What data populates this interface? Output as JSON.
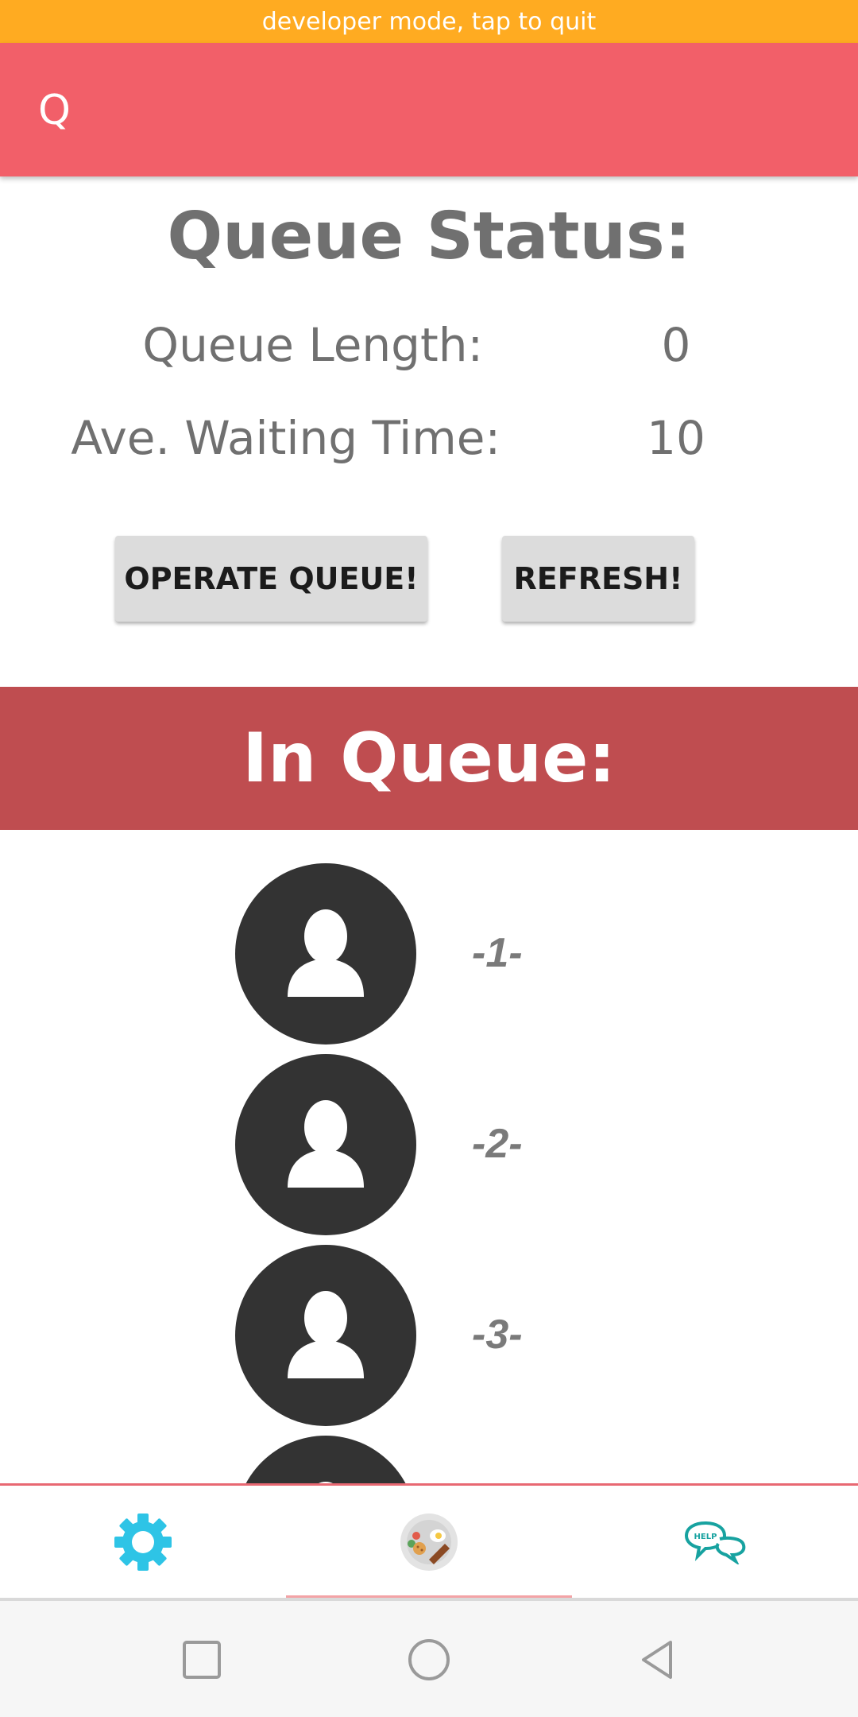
{
  "dev_banner": {
    "text": "developer mode, tap to quit"
  },
  "app_bar": {
    "title": "Q",
    "color": "#F25F69"
  },
  "queue_status": {
    "title": "Queue Status:",
    "length_label": "Queue Length:",
    "length_value": "0",
    "wait_label": "Ave. Waiting Time:",
    "wait_value": "10"
  },
  "actions": {
    "operate_label": "OPERATE QUEUE!",
    "refresh_label": "REFRESH!"
  },
  "in_queue": {
    "title": "In Queue:",
    "banner_color": "#BF4D50",
    "items": [
      {
        "label": "-1-"
      },
      {
        "label": "-2-"
      },
      {
        "label": "-3-"
      },
      {
        "label": ""
      }
    ]
  },
  "bottom_nav": {
    "tabs": [
      {
        "icon": "gear-icon",
        "selected": false
      },
      {
        "icon": "food-plate-icon",
        "selected": true
      },
      {
        "icon": "help-chat-icon",
        "selected": false
      }
    ],
    "help_icon_text": "HELP"
  },
  "system_nav": {
    "buttons": [
      "recent-apps",
      "home",
      "back"
    ]
  }
}
